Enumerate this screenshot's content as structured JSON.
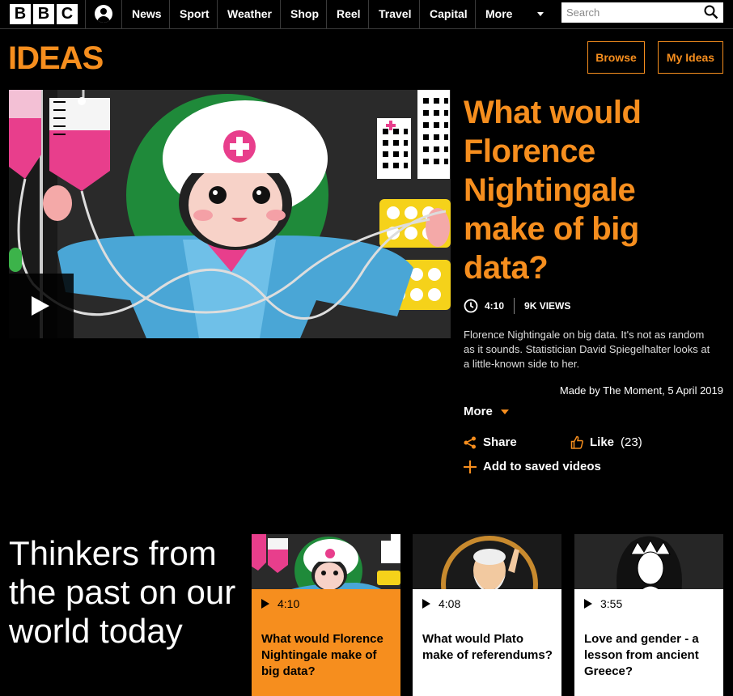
{
  "nav": {
    "logo_letters": [
      "B",
      "B",
      "C"
    ],
    "items": [
      "News",
      "Sport",
      "Weather",
      "Shop",
      "Reel",
      "Travel",
      "Capital",
      "More"
    ],
    "search_placeholder": "Search"
  },
  "header": {
    "brand": "IDEAS",
    "brand_color": "#f68e1e",
    "browse_label": "Browse",
    "my_ideas_label": "My Ideas"
  },
  "hero": {
    "title": "What would Florence Nightingale make of big data?",
    "duration": "4:10",
    "views": "9K VIEWS",
    "description": "Florence Nightingale on big data. It's not as random as it sounds. Statistician David Spiegelhalter looks at a little-known side to her.",
    "made_by": "Made by The Moment, 5 April 2019",
    "more_label": "More",
    "share_label": "Share",
    "like_label": "Like",
    "like_count": "(23)",
    "save_label": "Add to saved videos"
  },
  "section": {
    "title": "Thinkers from the past on our world today"
  },
  "cards": [
    {
      "duration": "4:10",
      "title": "What would Florence Nightingale make of big data?",
      "bg": "#f68e1e"
    },
    {
      "duration": "4:08",
      "title": "What would Plato make of referendums?",
      "bg": "#ffffff"
    },
    {
      "duration": "3:55",
      "title": "Love and gender - a lesson from ancient Greece?",
      "bg": "#ffffff"
    }
  ]
}
